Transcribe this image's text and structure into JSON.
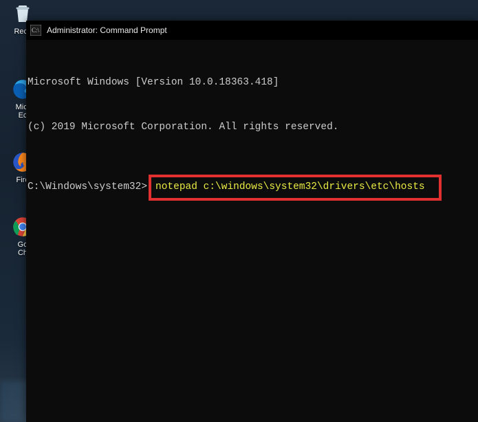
{
  "desktop": {
    "icons": [
      {
        "label": "Recy",
        "glyph": "recycle-bin"
      },
      {
        "label": "Micr\nEc",
        "glyph": "edge"
      },
      {
        "label": "Fire",
        "glyph": "firefox"
      },
      {
        "label": "Go\nCh",
        "glyph": "chrome"
      }
    ]
  },
  "window": {
    "title": "Administrator: Command Prompt"
  },
  "terminal": {
    "line1": "Microsoft Windows [Version 10.0.18363.418]",
    "line2": "(c) 2019 Microsoft Corporation. All rights reserved.",
    "prompt": "C:\\Windows\\system32>",
    "command": "notepad c:\\windows\\system32\\drivers\\etc\\hosts"
  }
}
